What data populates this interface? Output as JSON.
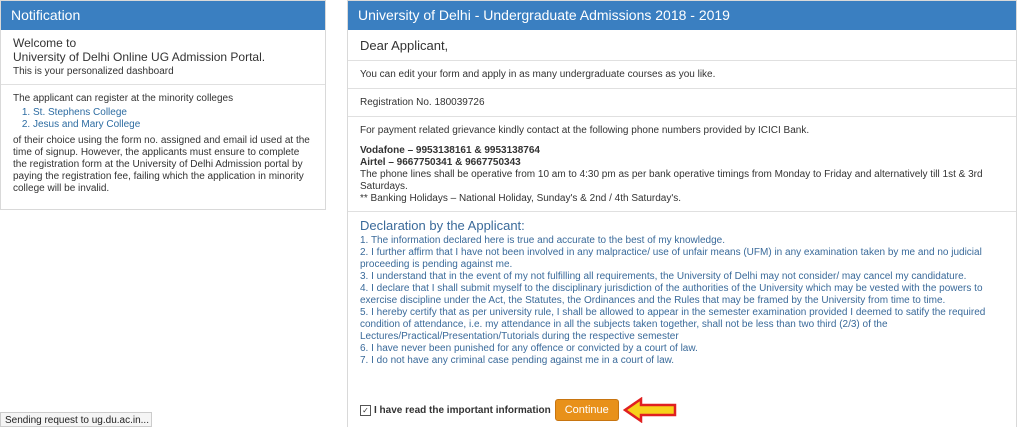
{
  "left": {
    "title": "Notification",
    "welcome_line1": "Welcome to",
    "welcome_line2": "University of Delhi Online UG Admission Portal.",
    "subtitle": "This is your personalized dashboard",
    "minority_intro": "The applicant can register at the minority colleges",
    "colleges": [
      "St. Stephens College",
      "Jesus and Mary College"
    ],
    "minority_note": "of their choice using the form no. assigned and email id used at the time of signup. However, the applicants must ensure to complete the registration form at the University of Delhi Admission portal by paying the registration fee, failing which the application in minority college will be invalid."
  },
  "right": {
    "title": "University of Delhi - Undergraduate Admissions 2018 - 2019",
    "greeting": "Dear Applicant,",
    "edit_note": "You can edit your form and apply in as many undergraduate courses as you like.",
    "registration": "Registration No. 180039726",
    "grievance": "For payment related grievance kindly contact at the following phone numbers provided by ICICI Bank.",
    "vodafone": "Vodafone – 9953138161 & 9953138764",
    "airtel": "Airtel – 9667750341 & 9667750343",
    "phone_hours": "The phone lines shall be operative from 10 am to 4:30 pm as per bank operative timings from Monday to Friday and alternatively till 1st & 3rd Saturdays.",
    "holidays": "** Banking Holidays – National Holiday, Sunday's & 2nd / 4th Saturday's.",
    "declaration_title": "Declaration by the Applicant:",
    "declarations": [
      "1. The information declared here is true and accurate to the best of my knowledge.",
      "2. I further affirm that I have not been involved in any malpractice/ use of unfair means (UFM) in any examination taken by me and no judicial proceeding is pending against me.",
      "3. I understand that in the event of my not fulfilling all requirements, the University of Delhi may not consider/ may cancel my candidature.",
      "4. I declare that I shall submit myself to the disciplinary jurisdiction of the authorities of the University which may be vested with the powers to exercise discipline under the Act, the Statutes, the Ordinances and the Rules that may be framed by the University from time to time.",
      "5. I hereby certify that as per university rule, I shall be allowed to appear in the semester examination provided I deemed to satify the required condition of attendance, i.e. my attendance in all the subjects taken together, shall not be less than two third (2/3) of the Lectures/Practical/Presentation/Tutorials during the respective semester",
      "6. I have never been punished for any offence or convicted by a court of law.",
      "7. I do not have any criminal case pending against me in a court of law."
    ],
    "checkbox_label": "I have read the important information",
    "continue_label": "Continue"
  },
  "status_text": "Sending request to ug.du.ac.in...",
  "colors": {
    "header": "#3a7fc1",
    "button": "#e8911a",
    "arrow": "#e02020"
  }
}
